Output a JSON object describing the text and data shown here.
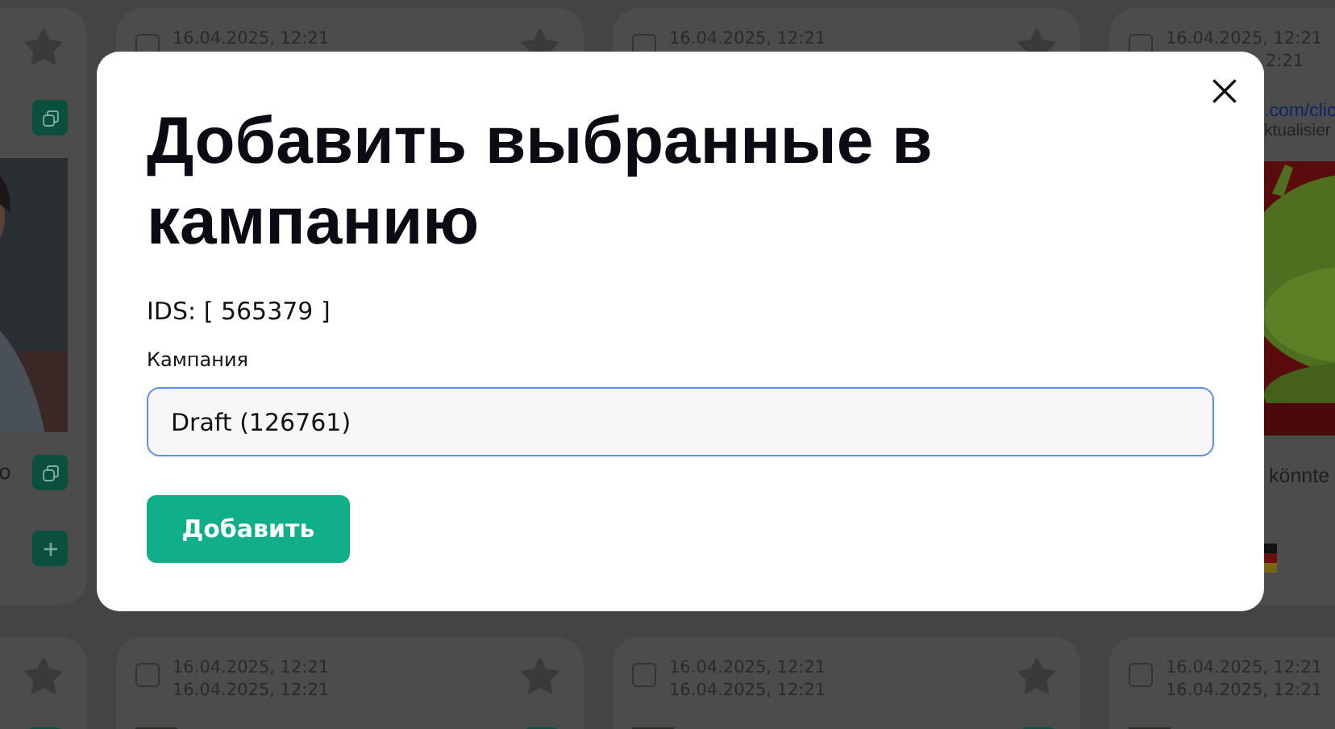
{
  "top_cards": [
    {
      "actions": [
        {
          "kind": "copy"
        }
      ],
      "picture": {
        "kind": "picture"
      },
      "caption": "o",
      "caption_action": {
        "kind": "copy"
      },
      "footer_action": {
        "kind": "add"
      }
    },
    {
      "checked": false,
      "dates": [
        "16.04.2025, 12:21"
      ]
    },
    {
      "checked": false,
      "dates": [
        "16.04.2025, 12:21"
      ]
    },
    {
      "checked": false,
      "dates": [
        "16.04.2025, 12:21"
      ],
      "fragments": [
        "2:21"
      ],
      "link": ".com/clic",
      "snippet": "ktualisier",
      "picture": {
        "kind": "picture"
      },
      "caption": "könnte"
    }
  ],
  "modal": {
    "title": "Добавить выбранные в кампанию",
    "ids": "IDS: [ 565379 ]",
    "field_label": "Кампания",
    "field_value": "Draft (126761)",
    "submit": "Добавить"
  },
  "bottom_cards": [
    {
      "checked": false,
      "dates": [
        "16.04.2025, 12:21",
        "16.04.2025, 12:21"
      ]
    },
    {
      "checked": false,
      "dates": [
        "16.04.2025, 12:21",
        "16.04.2025, 12:21"
      ]
    },
    {
      "checked": false,
      "dates": [
        "16.04.2025, 12:21",
        "16.04.2025, 12:21"
      ]
    }
  ]
}
